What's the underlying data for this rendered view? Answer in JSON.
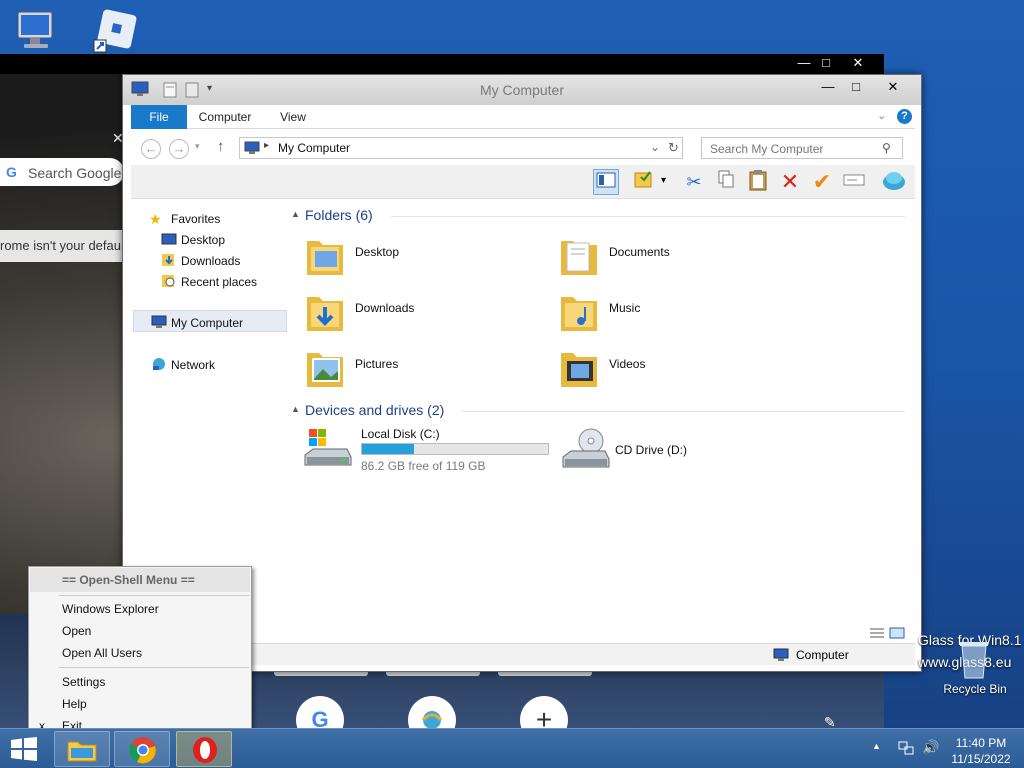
{
  "desktop": {
    "icons": [
      {
        "name": "computer-icon"
      },
      {
        "name": "roblox-icon"
      }
    ],
    "recycle_bin_label": "Recycle Bin",
    "glass_line1": "Glass for Win8.1",
    "glass_line2": "www.glass8.eu"
  },
  "chrome": {
    "search_placeholder": "Search Google",
    "default_banner": "rome isn't your defau",
    "shortcuts": [
      "G",
      "",
      "+"
    ]
  },
  "explorer": {
    "title": "My Computer",
    "tabs": [
      {
        "label": "File"
      },
      {
        "label": "Computer"
      },
      {
        "label": "View"
      }
    ],
    "address": "My Computer",
    "search_placeholder": "Search My Computer",
    "nav": {
      "favorites": "Favorites",
      "favorites_items": [
        "Desktop",
        "Downloads",
        "Recent places"
      ],
      "computer": "My Computer",
      "network": "Network"
    },
    "folders_header": "Folders (6)",
    "folders": [
      {
        "label": "Desktop",
        "icon": "folder-desktop-icon"
      },
      {
        "label": "Documents",
        "icon": "folder-documents-icon"
      },
      {
        "label": "Downloads",
        "icon": "folder-downloads-icon"
      },
      {
        "label": "Music",
        "icon": "folder-music-icon"
      },
      {
        "label": "Pictures",
        "icon": "folder-pictures-icon"
      },
      {
        "label": "Videos",
        "icon": "folder-videos-icon"
      }
    ],
    "drives_header": "Devices and drives (2)",
    "drives": [
      {
        "label": "Local Disk (C:)",
        "free_text": "86.2 GB free of 119 GB",
        "used_fraction": 0.28
      },
      {
        "label": "CD Drive (D:)"
      }
    ],
    "status_right": "Computer",
    "colors": {
      "accent": "#1979ca",
      "header": "#1e3f8a",
      "drive_fill": "#26a0da"
    }
  },
  "context_menu": {
    "header": "== Open-Shell Menu ==",
    "items": [
      "Windows Explorer",
      "Open",
      "Open All Users"
    ],
    "items2": [
      "Settings",
      "Help",
      "Exit"
    ],
    "exit_mark": "x"
  },
  "taskbar": {
    "time": "11:40 PM",
    "date": "11/15/2022"
  }
}
